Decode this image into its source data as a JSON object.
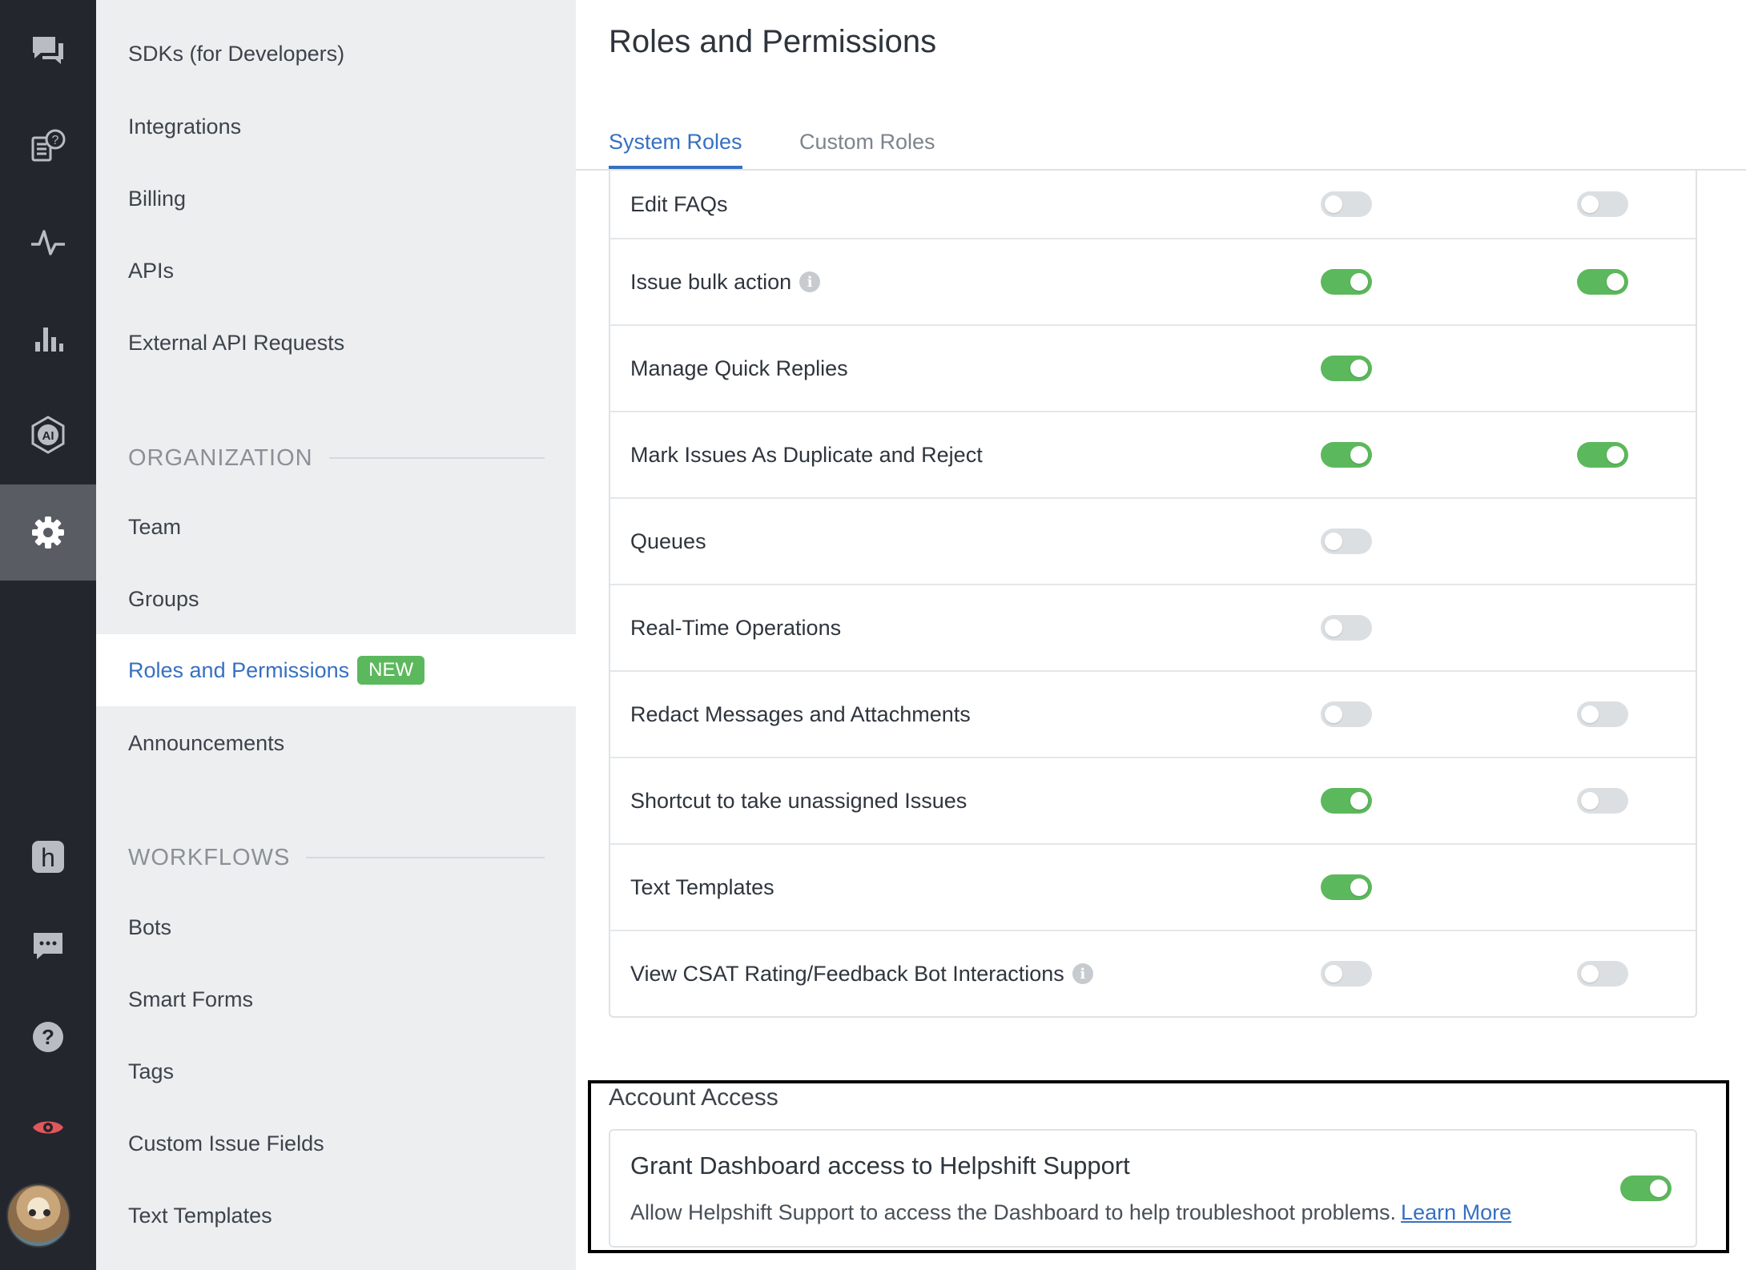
{
  "rail": {
    "items": [
      {
        "icon": "chat-bubbles-icon"
      },
      {
        "icon": "faq-icon"
      },
      {
        "icon": "activity-icon"
      },
      {
        "icon": "analytics-icon"
      },
      {
        "icon": "ai-icon"
      },
      {
        "icon": "settings-gear-icon",
        "active": true
      },
      {
        "icon": "helpshift-h-icon"
      },
      {
        "icon": "message-icon"
      },
      {
        "icon": "help-icon"
      },
      {
        "icon": "eye-icon"
      }
    ],
    "avatar": "user-avatar"
  },
  "nav": {
    "items_top": [
      "SDKs (for Developers)",
      "Integrations",
      "Billing",
      "APIs",
      "External API Requests"
    ],
    "org_heading": "ORGANIZATION",
    "org_items": [
      "Team",
      "Groups",
      "Roles and Permissions",
      "Announcements"
    ],
    "active_item": "Roles and Permissions",
    "new_badge": "NEW",
    "workflows_heading": "WORKFLOWS",
    "workflow_items": [
      "Bots",
      "Smart Forms",
      "Tags",
      "Custom Issue Fields",
      "Text Templates"
    ]
  },
  "main": {
    "title": "Roles and Permissions",
    "tabs": [
      "System Roles",
      "Custom Roles"
    ],
    "active_tab": "System Roles",
    "permissions": [
      {
        "label": "Edit FAQs",
        "info": false,
        "col1": "off",
        "col2": "off"
      },
      {
        "label": "Issue bulk action",
        "info": true,
        "col1": "on",
        "col2": "on"
      },
      {
        "label": "Manage Quick Replies",
        "info": false,
        "col1": "on",
        "col2": null
      },
      {
        "label": "Mark Issues As Duplicate and Reject",
        "info": false,
        "col1": "on",
        "col2": "on"
      },
      {
        "label": "Queues",
        "info": false,
        "col1": "off",
        "col2": null
      },
      {
        "label": "Real-Time Operations",
        "info": false,
        "col1": "off",
        "col2": null
      },
      {
        "label": "Redact Messages and Attachments",
        "info": false,
        "col1": "off",
        "col2": "off"
      },
      {
        "label": "Shortcut to take unassigned Issues",
        "info": false,
        "col1": "on",
        "col2": "off"
      },
      {
        "label": "Text Templates",
        "info": false,
        "col1": "on",
        "col2": null
      },
      {
        "label": "View CSAT Rating/Feedback Bot Interactions",
        "info": true,
        "col1": "off",
        "col2": "off"
      }
    ],
    "info_glyph": "i"
  },
  "account_access": {
    "heading": "Account Access",
    "card_title": "Grant Dashboard access to Helpshift Support",
    "description": "Allow Helpshift Support to access the Dashboard to help troubleshoot problems.",
    "link": "Learn More",
    "toggle": "on"
  },
  "colors": {
    "rail_bg": "#23262c",
    "nav_bg": "#eceef0",
    "accent_blue": "#3670c1",
    "toggle_on": "#5cb85c",
    "toggle_off": "#dcdfe2",
    "eye_icon": "#e0575b"
  }
}
